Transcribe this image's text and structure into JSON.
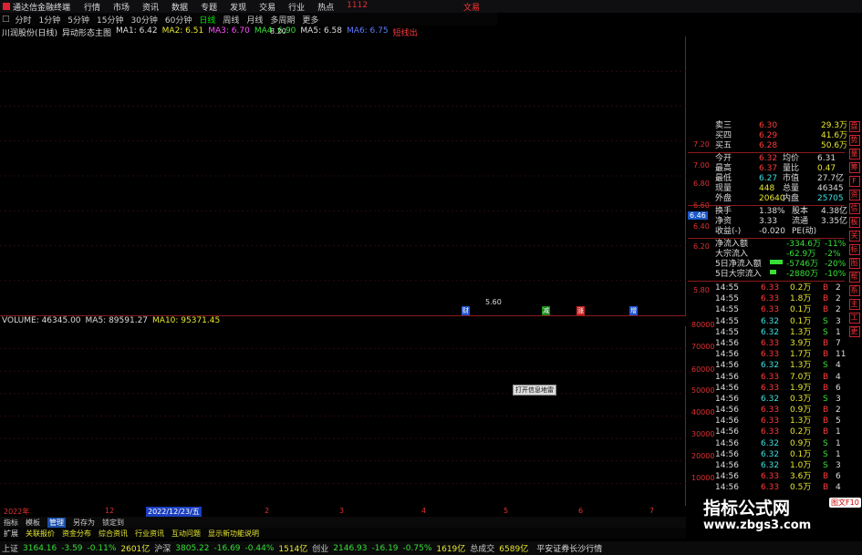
{
  "window": {
    "title": "通达信金融终端",
    "menu": [
      "行情",
      "市场",
      "资讯",
      "数据",
      "专题",
      "发现",
      "交易",
      "行业",
      "热点",
      "1112"
    ],
    "brand": "文易"
  },
  "periodbar": {
    "items": [
      "分时",
      "1分钟",
      "5分钟",
      "15分钟",
      "30分钟",
      "60分钟",
      "日线",
      "周线",
      "月线",
      "多周期",
      "更多"
    ],
    "active": "日线"
  },
  "chart_legend": {
    "stock": "川润股份(日线)",
    "indicator": "异动形态主图",
    "ma1": "MA1: 6.42",
    "ma2": "MA2: 6.51",
    "ma3": "MA3: 6.70",
    "ma4": "MA4: 6.90",
    "ma5": "MA5: 6.58",
    "ma6": "MA6: 6.75",
    "tag": "短线出"
  },
  "price_axis": [
    "7.20",
    "7.00",
    "6.80",
    "6.60",
    "6.40",
    "6.20",
    "5.80"
  ],
  "current_price_tag": "6.46",
  "high_label": "8.20",
  "low_label": "5.60",
  "signal_tags": [
    "财",
    "减",
    "涨",
    "增"
  ],
  "volume_legend": {
    "volume": "VOLUME: 46345.00",
    "ma5": "MA5: 89591.27",
    "ma10": "MA10: 95371.45"
  },
  "volume_axis": [
    "80000",
    "70000",
    "60000",
    "50000",
    "40000",
    "30000",
    "20000",
    "10000"
  ],
  "tooltip_label": "打开信息地雷",
  "x_axis": {
    "labels": [
      "2022年",
      "12",
      "2",
      "3",
      "4",
      "5",
      "6",
      "7"
    ],
    "highlight": "2022/12/23/五"
  },
  "bottom_tabs": {
    "row1": [
      "指标",
      "模板",
      "管理",
      "另存为",
      "锁定到"
    ],
    "row1_active": "管理",
    "row2": [
      "扩展",
      "关联报价",
      "资金分布",
      "综合资讯",
      "行业资讯",
      "互动问题",
      "显示新功能说明"
    ]
  },
  "status": [
    {
      "name": "上证",
      "value": "3164.16",
      "change": "-3.59",
      "pct": "-0.11%",
      "amount": "2601亿"
    },
    {
      "name": "沪深",
      "value": "3805.22",
      "change": "-16.69",
      "pct": "-0.44%",
      "amount": "1514亿"
    },
    {
      "name": "创业",
      "value": "2146.93",
      "change": "-16.19",
      "pct": "-0.75%",
      "amount": "1619亿"
    }
  ],
  "status_total": {
    "label": "总成交",
    "amount": "6589亿"
  },
  "broker": "平安证券长沙行情",
  "quote": {
    "book": [
      {
        "label": "卖三",
        "price": "6.30",
        "vol": "29.3万"
      },
      {
        "label": "买四",
        "price": "6.29",
        "vol": "41.6万"
      },
      {
        "label": "买五",
        "price": "6.28",
        "vol": "50.6万"
      }
    ],
    "stats": [
      {
        "l1": "今开",
        "v1": "6.32",
        "l2": "均价",
        "v2": "6.31"
      },
      {
        "l1": "最高",
        "v1": "6.37",
        "l2": "量比",
        "v2": "0.47"
      },
      {
        "l1": "最低",
        "v1": "6.27",
        "l2": "市值",
        "v2": "27.7亿"
      },
      {
        "l1": "现量",
        "v1": "448",
        "l2": "总量",
        "v2": "46345"
      },
      {
        "l1": "外盘",
        "v1": "20640",
        "l2": "内盘",
        "v2": "25705"
      }
    ],
    "stats2": [
      {
        "l1": "换手",
        "v1": "1.38%",
        "l2": "股本",
        "v2": "4.38亿"
      },
      {
        "l1": "净资",
        "v1": "3.33",
        "l2": "流通",
        "v2": "3.35亿"
      },
      {
        "l1": "收益(-)",
        "v1": "-0.020",
        "l2": "PE(动)",
        "v2": ""
      }
    ],
    "flows": [
      {
        "label": "净流入额",
        "value": "-334.6万",
        "pct": "-11%",
        "bar": 0
      },
      {
        "label": "大宗流入",
        "value": "-62.9万",
        "pct": "-2%",
        "bar": 0
      },
      {
        "label": "5日净流入额",
        "value": "-5746万",
        "pct": "-20%",
        "bar": 0.8
      },
      {
        "label": "5日大宗流入",
        "value": "-2880万",
        "pct": "-10%",
        "bar": 0.4
      }
    ],
    "ticks": [
      {
        "time": "14:55",
        "price": "6.33",
        "vol": "0.2万",
        "bs": "B",
        "n": "2"
      },
      {
        "time": "14:55",
        "price": "6.33",
        "vol": "1.8万",
        "bs": "B",
        "n": "2"
      },
      {
        "time": "14:55",
        "price": "6.33",
        "vol": "0.1万",
        "bs": "B",
        "n": "2"
      },
      {
        "time": "14:55",
        "price": "6.32",
        "vol": "0.1万",
        "bs": "S",
        "n": "3"
      },
      {
        "time": "14:55",
        "price": "6.32",
        "vol": "1.3万",
        "bs": "S",
        "n": "1"
      },
      {
        "time": "14:56",
        "price": "6.33",
        "vol": "3.9万",
        "bs": "B",
        "n": "7"
      },
      {
        "time": "14:56",
        "price": "6.33",
        "vol": "1.7万",
        "bs": "B",
        "n": "11"
      },
      {
        "time": "14:56",
        "price": "6.32",
        "vol": "1.3万",
        "bs": "S",
        "n": "4"
      },
      {
        "time": "14:56",
        "price": "6.33",
        "vol": "7.0万",
        "bs": "B",
        "n": "4"
      },
      {
        "time": "14:56",
        "price": "6.33",
        "vol": "1.9万",
        "bs": "B",
        "n": "6"
      },
      {
        "time": "14:56",
        "price": "6.32",
        "vol": "0.3万",
        "bs": "S",
        "n": "3"
      },
      {
        "time": "14:56",
        "price": "6.33",
        "vol": "0.9万",
        "bs": "B",
        "n": "2"
      },
      {
        "time": "14:56",
        "price": "6.33",
        "vol": "1.3万",
        "bs": "B",
        "n": "5"
      },
      {
        "time": "14:56",
        "price": "6.33",
        "vol": "0.2万",
        "bs": "B",
        "n": "1"
      },
      {
        "time": "14:56",
        "price": "6.32",
        "vol": "0.9万",
        "bs": "S",
        "n": "1"
      },
      {
        "time": "14:56",
        "price": "6.32",
        "vol": "0.1万",
        "bs": "S",
        "n": "1"
      },
      {
        "time": "14:56",
        "price": "6.32",
        "vol": "1.0万",
        "bs": "S",
        "n": "3"
      },
      {
        "time": "14:56",
        "price": "6.33",
        "vol": "3.6万",
        "bs": "B",
        "n": "6"
      },
      {
        "time": "14:56",
        "price": "6.33",
        "vol": "0.5万",
        "bs": "B",
        "n": "4"
      }
    ]
  },
  "sidebar_icons": [
    "盘",
    "势",
    "量",
    "筹",
    "F",
    "资",
    "信",
    "板",
    "关",
    "标",
    "图",
    "帮",
    "系",
    "主",
    "工",
    "更"
  ],
  "watermark": {
    "title": "指标公式网",
    "url": "www.zbgs3.com",
    "badge": "图文F10"
  },
  "colors": {
    "up": "#ff3a3a",
    "down": "#3ee0e0",
    "ma_yellow": "#e8e830",
    "ma_green": "#36e036",
    "ma_pink": "#ff50ff",
    "ma_blue": "#5e7dff",
    "frame": "#8a1a1a"
  }
}
